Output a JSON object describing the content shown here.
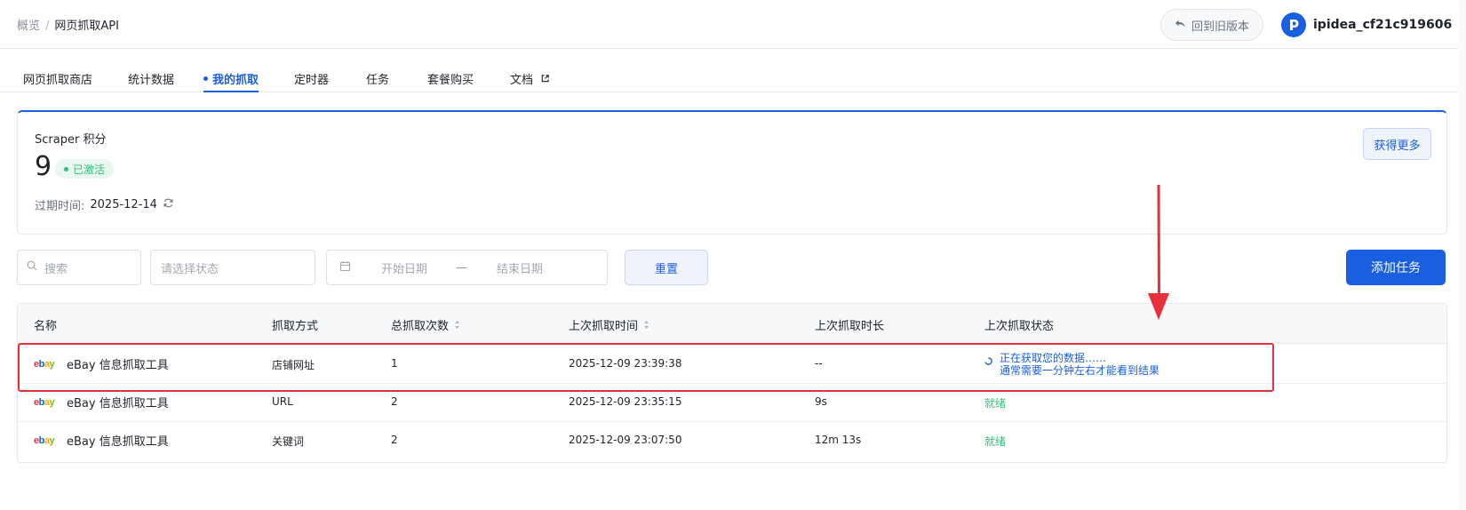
{
  "breadcrumb": {
    "root": "概览",
    "separator": "/",
    "current": "网页抓取API"
  },
  "header": {
    "old_version_label": "回到旧版本",
    "username": "ipidea_cf21c919606"
  },
  "tabs": [
    {
      "label": "网页抓取商店"
    },
    {
      "label": "统计数据"
    },
    {
      "label": "我的抓取"
    },
    {
      "label": "定时器"
    },
    {
      "label": "任务"
    },
    {
      "label": "套餐购买"
    },
    {
      "label": "文档"
    }
  ],
  "scraper_card": {
    "title": "Scraper 积分",
    "points": "9",
    "status": "已激活",
    "expire_label": "过期时间:",
    "expire_date": "2025-12-14",
    "get_more_label": "获得更多"
  },
  "filters": {
    "search_placeholder": "搜索",
    "status_placeholder": "请选择状态",
    "start_date_placeholder": "开始日期",
    "date_separator": "—",
    "end_date_placeholder": "结束日期",
    "reset_label": "重置",
    "add_task_label": "添加任务"
  },
  "table": {
    "columns": [
      "名称",
      "抓取方式",
      "总抓取次数",
      "上次抓取时间",
      "上次抓取时长",
      "上次抓取状态"
    ],
    "rows": [
      {
        "name": "eBay 信息抓取工具",
        "method": "店铺网址",
        "count": "1",
        "last_time": "2025-12-09 23:39:38",
        "duration": "--",
        "status_line1": "正在获取您的数据……",
        "status_line2": "通常需要一分钟左右才能看到结果"
      },
      {
        "name": "eBay 信息抓取工具",
        "method": "URL",
        "count": "2",
        "last_time": "2025-12-09 23:35:15",
        "duration": "9s",
        "status": "就绪"
      },
      {
        "name": "eBay 信息抓取工具",
        "method": "关键词",
        "count": "2",
        "last_time": "2025-12-09 23:07:50",
        "duration": "12m 13s",
        "status": "就绪"
      }
    ]
  },
  "logo_text": {
    "e": "e",
    "b": "b",
    "a": "a",
    "y": "y"
  },
  "colors": {
    "accent": "#1a5fe0",
    "success": "#2fbf7a",
    "highlight": "#e8303a"
  }
}
